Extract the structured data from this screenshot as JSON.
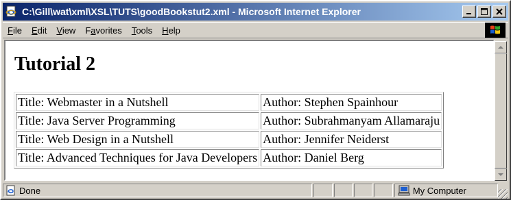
{
  "window": {
    "title": "C:\\Gill\\wat\\xml\\XSL\\TUTS\\goodBookstut2.xml - Microsoft Internet Explorer"
  },
  "menu": [
    {
      "label": "File",
      "accel": "F",
      "rest": "ile"
    },
    {
      "label": "Edit",
      "accel": "E",
      "rest": "dit"
    },
    {
      "label": "View",
      "accel": "V",
      "rest": "iew"
    },
    {
      "label": "Favorites",
      "accel": "a",
      "pre": "F",
      "rest": "vorites"
    },
    {
      "label": "Tools",
      "accel": "T",
      "rest": "ools"
    },
    {
      "label": "Help",
      "accel": "H",
      "rest": "elp"
    }
  ],
  "page": {
    "heading": "Tutorial 2",
    "books": [
      {
        "title": "Title: Webmaster in a Nutshell",
        "author": "Author: Stephen Spainhour"
      },
      {
        "title": "Title: Java Server Programming",
        "author": "Author: Subrahmanyam Allamaraju"
      },
      {
        "title": "Title: Web Design in a Nutshell",
        "author": "Author: Jennifer Neiderst"
      },
      {
        "title": "Title: Advanced Techniques for Java Developers",
        "author": "Author: Daniel Berg"
      }
    ]
  },
  "status": {
    "text": "Done",
    "zone": "My Computer"
  },
  "icons": {
    "app": "ie-page-icon",
    "status": "ie-page-icon",
    "zone": "computer-icon",
    "logo": "windows-logo"
  },
  "colors": {
    "titlebar_start": "#0a246a",
    "titlebar_end": "#a6caf0",
    "chrome": "#d4d0c8"
  }
}
